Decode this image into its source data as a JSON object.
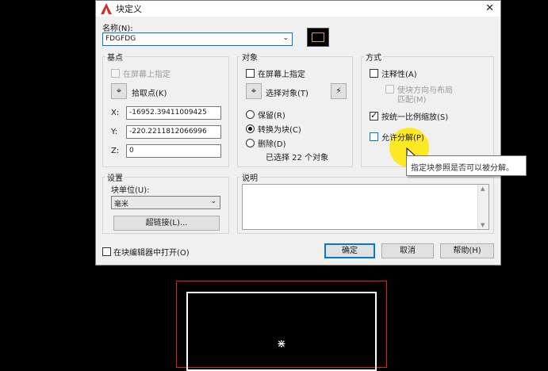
{
  "window": {
    "title": "块定义",
    "close_glyph": "✕"
  },
  "name": {
    "label": "名称(N):",
    "value": "FDGFDG"
  },
  "base_point": {
    "group_title": "基点",
    "specify_on_screen": "在屏幕上指定",
    "pick_point": "拾取点(K)",
    "x_label": "X:",
    "x_value": "-16952.39411009425",
    "y_label": "Y:",
    "y_value": "-220.2211812066996",
    "z_label": "Z:",
    "z_value": "0"
  },
  "objects": {
    "group_title": "对象",
    "specify_on_screen": "在屏幕上指定",
    "select_objects": "选择对象(T)",
    "retain": "保留(R)",
    "convert_to_block": "转换为块(C)",
    "delete": "删除(D)",
    "selected_count": "已选择 22 个对象"
  },
  "behavior": {
    "group_title": "方式",
    "annotative": "注释性(A)",
    "match_orientation": "使块方向与布局",
    "match_orientation_2": "匹配(M)",
    "scale_uniformly": "按统一比例缩放(S)",
    "allow_exploding": "允许分解(P)"
  },
  "settings": {
    "group_title": "设置",
    "block_unit_label": "块单位(U):",
    "block_unit_value": "毫米",
    "hyperlink": "超链接(L)..."
  },
  "description": {
    "group_title": "说明"
  },
  "footer": {
    "open_in_editor": "在块编辑器中打开(O)",
    "ok": "确定",
    "cancel": "取消",
    "help": "帮助(H)"
  },
  "tooltip": {
    "text": "指定块参照是否可以被分解。"
  },
  "drawing": {
    "symbol": "⋇"
  },
  "colors": {
    "accent": "#0078d7",
    "drawing_red": "#e02020",
    "drawing_white": "#ffffff",
    "cursor_highlight": "#ffe600"
  }
}
